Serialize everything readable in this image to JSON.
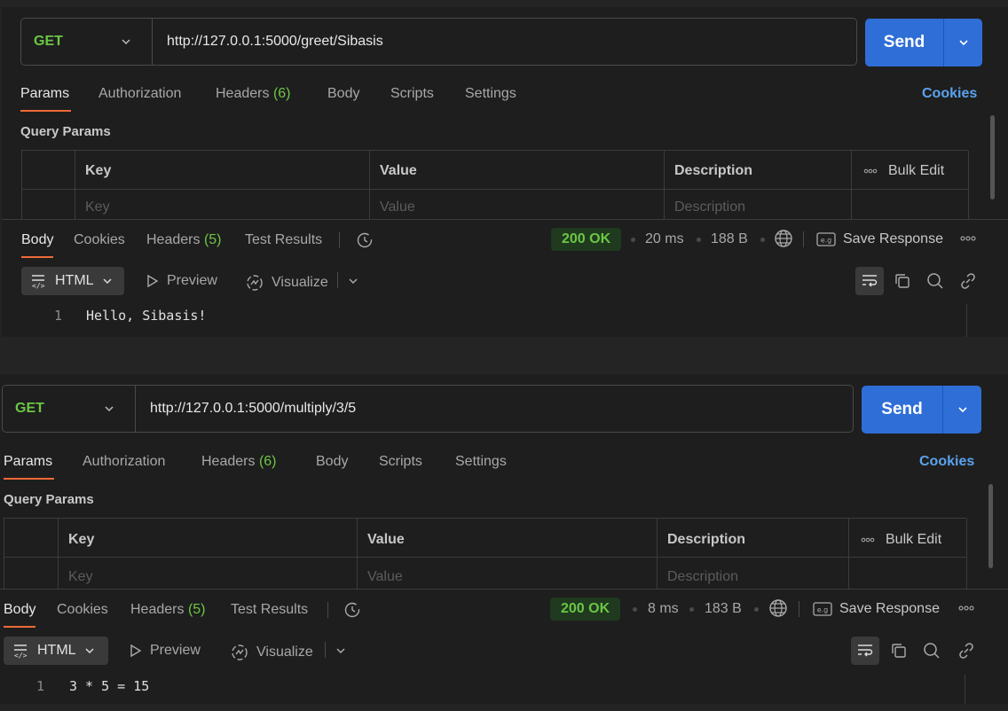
{
  "requests": [
    {
      "method": "GET",
      "url": "http://127.0.0.1:5000/greet/Sibasis",
      "send_label": "Send",
      "tabs": {
        "params": "Params",
        "authorization": "Authorization",
        "headers": "Headers",
        "headers_count": "(6)",
        "body": "Body",
        "scripts": "Scripts",
        "settings": "Settings"
      },
      "cookies": "Cookies",
      "query_params_title": "Query Params",
      "table": {
        "key": "Key",
        "value": "Value",
        "description": "Description",
        "bulk_edit": "Bulk Edit",
        "key_ph": "Key",
        "value_ph": "Value",
        "description_ph": "Description"
      },
      "response": {
        "tabs": {
          "body": "Body",
          "cookies": "Cookies",
          "headers": "Headers",
          "headers_count": "(5)",
          "tests": "Test Results"
        },
        "status": "200 OK",
        "time": "20 ms",
        "size": "188 B",
        "save": "Save Response",
        "format": "HTML",
        "preview": "Preview",
        "visualize": "Visualize",
        "line_number": "1",
        "body": "Hello, Sibasis!"
      }
    },
    {
      "method": "GET",
      "url": "http://127.0.0.1:5000/multiply/3/5",
      "send_label": "Send",
      "tabs": {
        "params": "Params",
        "authorization": "Authorization",
        "headers": "Headers",
        "headers_count": "(6)",
        "body": "Body",
        "scripts": "Scripts",
        "settings": "Settings"
      },
      "cookies": "Cookies",
      "query_params_title": "Query Params",
      "table": {
        "key": "Key",
        "value": "Value",
        "description": "Description",
        "bulk_edit": "Bulk Edit",
        "key_ph": "Key",
        "value_ph": "Value",
        "description_ph": "Description"
      },
      "response": {
        "tabs": {
          "body": "Body",
          "cookies": "Cookies",
          "headers": "Headers",
          "headers_count": "(5)",
          "tests": "Test Results"
        },
        "status": "200 OK",
        "time": "8 ms",
        "size": "183 B",
        "save": "Save Response",
        "format": "HTML",
        "preview": "Preview",
        "visualize": "Visualize",
        "line_number": "1",
        "body": "3 * 5 = 15"
      }
    }
  ],
  "colors": {
    "send": "#2f6ed6",
    "method": "#6cc644",
    "cookies": "#5aa3f0",
    "active_tab": "#ef6a38"
  }
}
